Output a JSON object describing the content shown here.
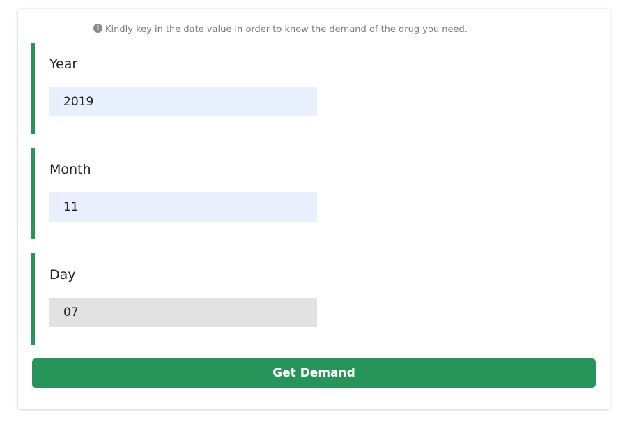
{
  "hint": {
    "icon": "exclamation-circle-icon",
    "icon_glyph": "!",
    "text": "Kindly key in the date value in order to know the demand of the drug you need."
  },
  "fields": [
    {
      "label": "Year",
      "value": "2019"
    },
    {
      "label": "Month",
      "value": "11"
    },
    {
      "label": "Day",
      "value": "07"
    }
  ],
  "submit": {
    "label": "Get Demand"
  },
  "colors": {
    "accent": "#27955a",
    "autofill_bg": "#e8f0fe",
    "focused_bg": "#e3e2e2"
  }
}
